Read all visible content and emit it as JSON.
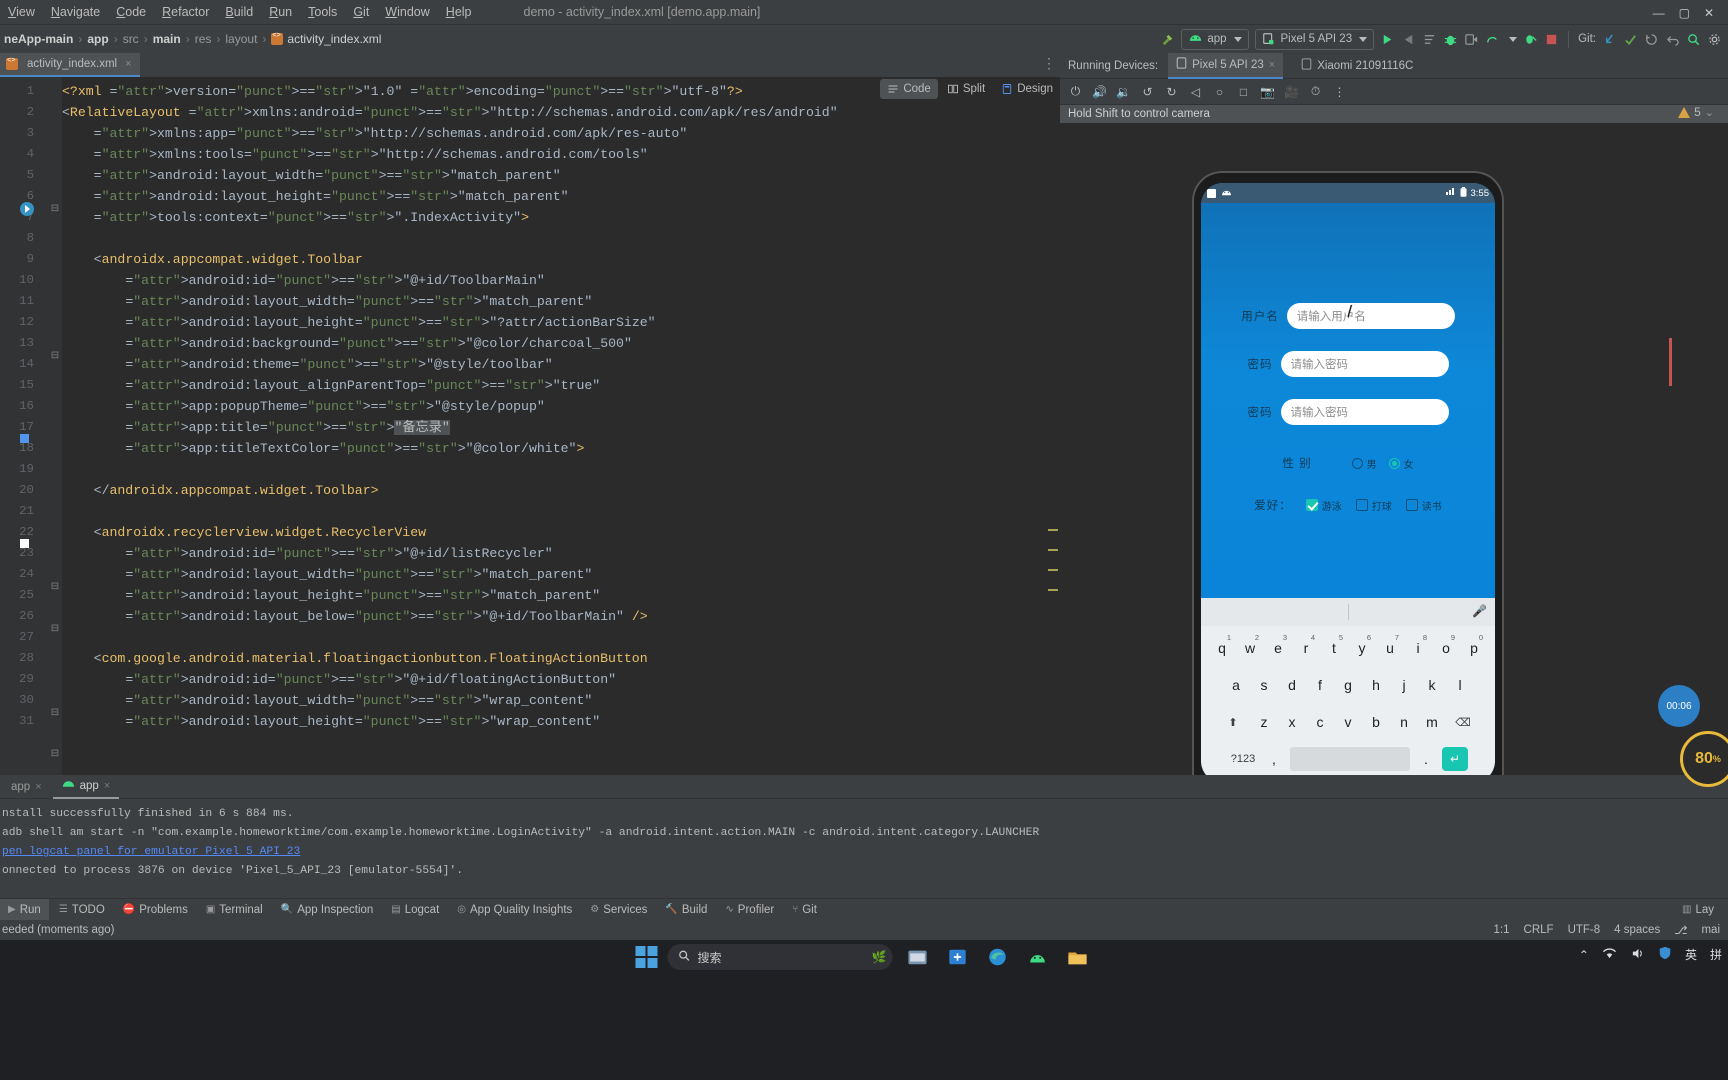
{
  "window": {
    "title": "demo - activity_index.xml [demo.app.main]",
    "controls": [
      "—",
      "▢",
      "✕"
    ]
  },
  "menubar": {
    "items": [
      "View",
      "Navigate",
      "Code",
      "Refactor",
      "Build",
      "Run",
      "Tools",
      "Git",
      "Window",
      "Help"
    ]
  },
  "breadcrumb": {
    "items": [
      "neApp-main",
      "app",
      "src",
      "main",
      "res",
      "layout",
      "activity_index.xml"
    ],
    "separator": "›"
  },
  "toolbar": {
    "module_label": "app",
    "device_label": "Pixel 5 API 23",
    "git_label": "Git:",
    "icons": [
      "hammer-icon",
      "android-icon",
      "device-icon",
      "run-icon",
      "rerun-icon",
      "list-icon",
      "debug-icon",
      "run-with-coverage-icon",
      "profiler-icon",
      "attach-debugger-icon",
      "stop-icon",
      "update-project-icon",
      "commit-icon",
      "history-icon",
      "rollback-icon",
      "search-everywhere-icon",
      "settings-icon"
    ]
  },
  "editor_tabs": {
    "tabs": [
      {
        "label": "activity_index.xml",
        "close": "×"
      }
    ]
  },
  "mode_switch": {
    "items": [
      {
        "label": "Code",
        "active": true
      },
      {
        "label": "Split",
        "active": false
      },
      {
        "label": "Design",
        "active": false
      }
    ]
  },
  "inspections": {
    "count": "5",
    "chevron": "⌄"
  },
  "code": {
    "lines": [
      {
        "n": "1",
        "text": "<?xml version=\"1.0\" encoding=\"utf-8\"?>"
      },
      {
        "n": "2",
        "text": "<RelativeLayout xmlns:android=\"http://schemas.android.com/apk/res/android\""
      },
      {
        "n": "3",
        "text": "    xmlns:app=\"http://schemas.android.com/apk/res-auto\""
      },
      {
        "n": "4",
        "text": "    xmlns:tools=\"http://schemas.android.com/tools\""
      },
      {
        "n": "5",
        "text": "    android:layout_width=\"match_parent\""
      },
      {
        "n": "6",
        "text": "    android:layout_height=\"match_parent\""
      },
      {
        "n": "7",
        "text": "    tools:context=\".IndexActivity\">"
      },
      {
        "n": "8",
        "text": ""
      },
      {
        "n": "9",
        "text": "    <androidx.appcompat.widget.Toolbar"
      },
      {
        "n": "10",
        "text": "        android:id=\"@+id/ToolbarMain\""
      },
      {
        "n": "11",
        "text": "        android:layout_width=\"match_parent\""
      },
      {
        "n": "12",
        "text": "        android:layout_height=\"?attr/actionBarSize\""
      },
      {
        "n": "13",
        "text": "        android:background=\"@color/charcoal_500\""
      },
      {
        "n": "14",
        "text": "        android:theme=\"@style/toolbar\""
      },
      {
        "n": "15",
        "text": "        android:layout_alignParentTop=\"true\""
      },
      {
        "n": "16",
        "text": "        app:popupTheme=\"@style/popup\""
      },
      {
        "n": "17",
        "text": "        app:title=\"备忘录\""
      },
      {
        "n": "18",
        "text": "        app:titleTextColor=\"@color/white\">"
      },
      {
        "n": "19",
        "text": ""
      },
      {
        "n": "20",
        "text": "    </androidx.appcompat.widget.Toolbar>"
      },
      {
        "n": "21",
        "text": ""
      },
      {
        "n": "22",
        "text": "    <androidx.recyclerview.widget.RecyclerView"
      },
      {
        "n": "23",
        "text": "        android:id=\"@+id/listRecycler\""
      },
      {
        "n": "24",
        "text": "        android:layout_width=\"match_parent\""
      },
      {
        "n": "25",
        "text": "        android:layout_height=\"match_parent\""
      },
      {
        "n": "26",
        "text": "        android:layout_below=\"@+id/ToolbarMain\" />"
      },
      {
        "n": "27",
        "text": ""
      },
      {
        "n": "28",
        "text": "    <com.google.android.material.floatingactionbutton.FloatingActionButton"
      },
      {
        "n": "29",
        "text": "        android:id=\"@+id/floatingActionButton\""
      },
      {
        "n": "30",
        "text": "        android:layout_width=\"wrap_content\""
      },
      {
        "n": "31",
        "text": "        android:layout_height=\"wrap_content\""
      }
    ]
  },
  "devices": {
    "header_label": "Running Devices:",
    "tabs": [
      {
        "label": "Pixel 5 API 23",
        "close": "×",
        "active": true
      },
      {
        "label": "Xiaomi 21091116C",
        "close": "",
        "active": false
      }
    ],
    "hint": "Hold Shift to control camera",
    "toolbar_icons": [
      "power-icon",
      "volume-up-icon",
      "volume-down-icon",
      "rotate-left-icon",
      "rotate-right-icon",
      "back-icon",
      "screenshot-icon",
      "record-icon",
      "snapshot-icon",
      "more-icon"
    ]
  },
  "emulator": {
    "status_bar": {
      "time": "3:55",
      "signal": "signal-icon",
      "battery": "battery-icon"
    },
    "form": {
      "rows": [
        {
          "label": "用户名",
          "placeholder": "请输入用户名"
        },
        {
          "label": "密码",
          "placeholder": "请输入密码"
        },
        {
          "label": "密码",
          "placeholder": "请输入密码"
        }
      ],
      "gender": {
        "label": "性 别",
        "options": [
          {
            "label": "男",
            "checked": false
          },
          {
            "label": "女",
            "checked": true
          }
        ]
      },
      "hobby": {
        "label": "爱好：",
        "options": [
          {
            "label": "游泳",
            "checked": true
          },
          {
            "label": "打球",
            "checked": false
          },
          {
            "label": "读书",
            "checked": false
          }
        ]
      }
    },
    "keyboard": {
      "row1": [
        {
          "k": "q",
          "n": "1"
        },
        {
          "k": "w",
          "n": "2"
        },
        {
          "k": "e",
          "n": "3"
        },
        {
          "k": "r",
          "n": "4"
        },
        {
          "k": "t",
          "n": "5"
        },
        {
          "k": "y",
          "n": "6"
        },
        {
          "k": "u",
          "n": "7"
        },
        {
          "k": "i",
          "n": "8"
        },
        {
          "k": "o",
          "n": "9"
        },
        {
          "k": "p",
          "n": "0"
        }
      ],
      "row2": [
        "a",
        "s",
        "d",
        "f",
        "g",
        "h",
        "j",
        "k",
        "l"
      ],
      "row3": [
        "z",
        "x",
        "c",
        "v",
        "b",
        "n",
        "m"
      ],
      "shift": "⬆",
      "backspace": "⌫",
      "sym": "?123",
      "comma": ",",
      "period": ".",
      "enter": "↵",
      "space": ""
    },
    "nav_buttons": [
      "▽",
      "○",
      "□",
      "⌨"
    ],
    "timer_badge": "00:06",
    "zoom_badge": "80",
    "zoom_badge_sub": "%"
  },
  "run_panel": {
    "tabs": [
      {
        "label": "app",
        "close": "×",
        "active": false
      },
      {
        "label": "app",
        "close": "×",
        "active": true
      }
    ],
    "console": [
      {
        "text": "nstall successfully finished in 6 s 884 ms.",
        "link": false
      },
      {
        "text": "adb shell am start -n \"com.example.homeworktime/com.example.homeworktime.LoginActivity\" -a android.intent.action.MAIN -c android.intent.category.LAUNCHER",
        "link": false
      },
      {
        "text": "pen logcat panel for emulator Pixel 5 API 23",
        "link": true
      },
      {
        "text": "onnected to process 3876 on device 'Pixel_5_API_23 [emulator-5554]'.",
        "link": false
      }
    ]
  },
  "tool_windows": {
    "items": [
      {
        "label": "Run",
        "icon": "run-icon",
        "active": true
      },
      {
        "label": "TODO",
        "icon": "todo-icon",
        "active": false
      },
      {
        "label": "Problems",
        "icon": "problems-icon",
        "active": false
      },
      {
        "label": "Terminal",
        "icon": "terminal-icon",
        "active": false
      },
      {
        "label": "App Inspection",
        "icon": "inspection-icon",
        "active": false
      },
      {
        "label": "Logcat",
        "icon": "logcat-icon",
        "active": false
      },
      {
        "label": "App Quality Insights",
        "icon": "insights-icon",
        "active": false
      },
      {
        "label": "Services",
        "icon": "services-icon",
        "active": false
      },
      {
        "label": "Build",
        "icon": "build-icon",
        "active": false
      },
      {
        "label": "Profiler",
        "icon": "profiler-icon",
        "active": false
      },
      {
        "label": "Git",
        "icon": "git-icon",
        "active": false
      }
    ],
    "right_items": [
      {
        "label": "Lay",
        "icon": "layout-inspector-icon"
      }
    ]
  },
  "status_bar": {
    "message": "eeded (moments ago)",
    "caret": "1:1",
    "line_sep": "CRLF",
    "encoding": "UTF-8",
    "indent": "4 spaces",
    "branch": "mai"
  },
  "taskbar": {
    "search_placeholder": "搜索",
    "apps": [
      "file-explorer-icon",
      "store-icon",
      "edge-icon",
      "android-studio-icon",
      "folder-icon"
    ],
    "tray": [
      "chevron-up-icon",
      "wifi-icon",
      "volume-icon",
      "shield-icon",
      "ime-en",
      "ime-pin"
    ],
    "ime_en": "英",
    "ime_pin": "拼"
  },
  "colors": {
    "accent": "#4a88c7",
    "ide_bg": "#3c3f41",
    "editor_bg": "#2b2b2b",
    "android_blue": "#0a84d8",
    "teal": "#19c6b1",
    "warn": "#d9a343"
  }
}
